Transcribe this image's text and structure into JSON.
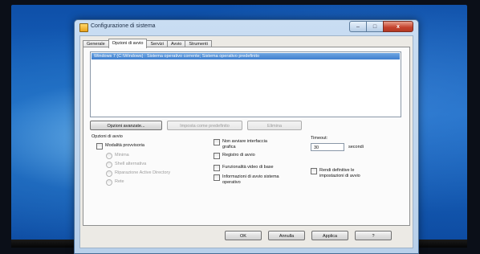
{
  "window": {
    "title": "Configurazione di sistema",
    "close_glyph": "x"
  },
  "tabs": [
    {
      "label": "Generale"
    },
    {
      "label": "Opzioni di avvio"
    },
    {
      "label": "Servizi"
    },
    {
      "label": "Avvio"
    },
    {
      "label": "Strumenti"
    }
  ],
  "boot_list": {
    "selected_entry": "Windows 7 (C:\\Windows) : Sistema operativo corrente; Sistema operativo predefinito"
  },
  "boot_buttons": {
    "advanced": "Opzioni avanzate...",
    "set_default": "Imposta come predefinito",
    "delete": "Elimina"
  },
  "boot_options": {
    "group_label": "Opzioni di avvio",
    "safe_boot": "Modalità provvisoria",
    "minimal": "Minima",
    "alternate_shell": "Shell alternativa",
    "active_directory_repair": "Riparazione Active Directory",
    "network": "Rete",
    "no_gui_boot": "Non avviare interfaccia grafica",
    "boot_log": "Registro di avvio",
    "base_video": "Funzionalità video di base",
    "os_boot_info": "Informazioni di avvio sistema operativo"
  },
  "timeout": {
    "label": "Timeout:",
    "value": "30",
    "unit": "secondi"
  },
  "permanent": {
    "label": "Rendi definitive le impostazioni di avvio"
  },
  "footer": {
    "ok": "OK",
    "cancel": "Annulla",
    "apply": "Applica",
    "help": "?"
  },
  "colors": {
    "selection": "#3f7fce",
    "close_button": "#c4412c",
    "desktop": "#1c6cc6"
  }
}
